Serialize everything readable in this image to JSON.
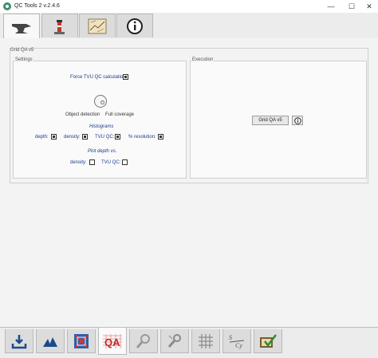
{
  "window": {
    "title": "QC Tools 2 v.2.4.6",
    "min": "—",
    "max": "☐",
    "close": "✕"
  },
  "top_tabs": [
    {
      "icon": "anvil-icon",
      "active": true
    },
    {
      "icon": "lighthouse-icon",
      "active": false
    },
    {
      "icon": "chart-map-icon",
      "active": false
    },
    {
      "icon": "info-icon",
      "active": false
    }
  ],
  "panel": {
    "title": "Grid QA v5"
  },
  "settings": {
    "title": "Settings",
    "force_tvu_label": "Force TVU QC calculation",
    "force_tvu_checked": true,
    "object_detection_label": "Object detection",
    "full_coverage_label": "Full coverage",
    "histograms_label": "Histograms",
    "hist_depth_label": "depth:",
    "hist_density_label": "density:",
    "hist_tvuqc_label": "TVU QC:",
    "hist_resolution_label": "% resolution:",
    "plot_depth_label": "Plot depth vs.",
    "plot_density_label": "density:",
    "plot_tvuqc_label": "TVU QC:"
  },
  "execution": {
    "title": "Execution",
    "run_button": "Grid QA v5",
    "info_icon": "info-icon"
  },
  "bottom_tabs": [
    {
      "icon": "import-icon"
    },
    {
      "icon": "triangles-icon"
    },
    {
      "icon": "grid-qa-icon"
    },
    {
      "icon": "qa-icon",
      "active": true
    },
    {
      "icon": "magnifier-icon"
    },
    {
      "icon": "inspector-icon"
    },
    {
      "icon": "grid-icon"
    },
    {
      "icon": "sdcy-icon"
    },
    {
      "icon": "check-book-icon"
    }
  ]
}
